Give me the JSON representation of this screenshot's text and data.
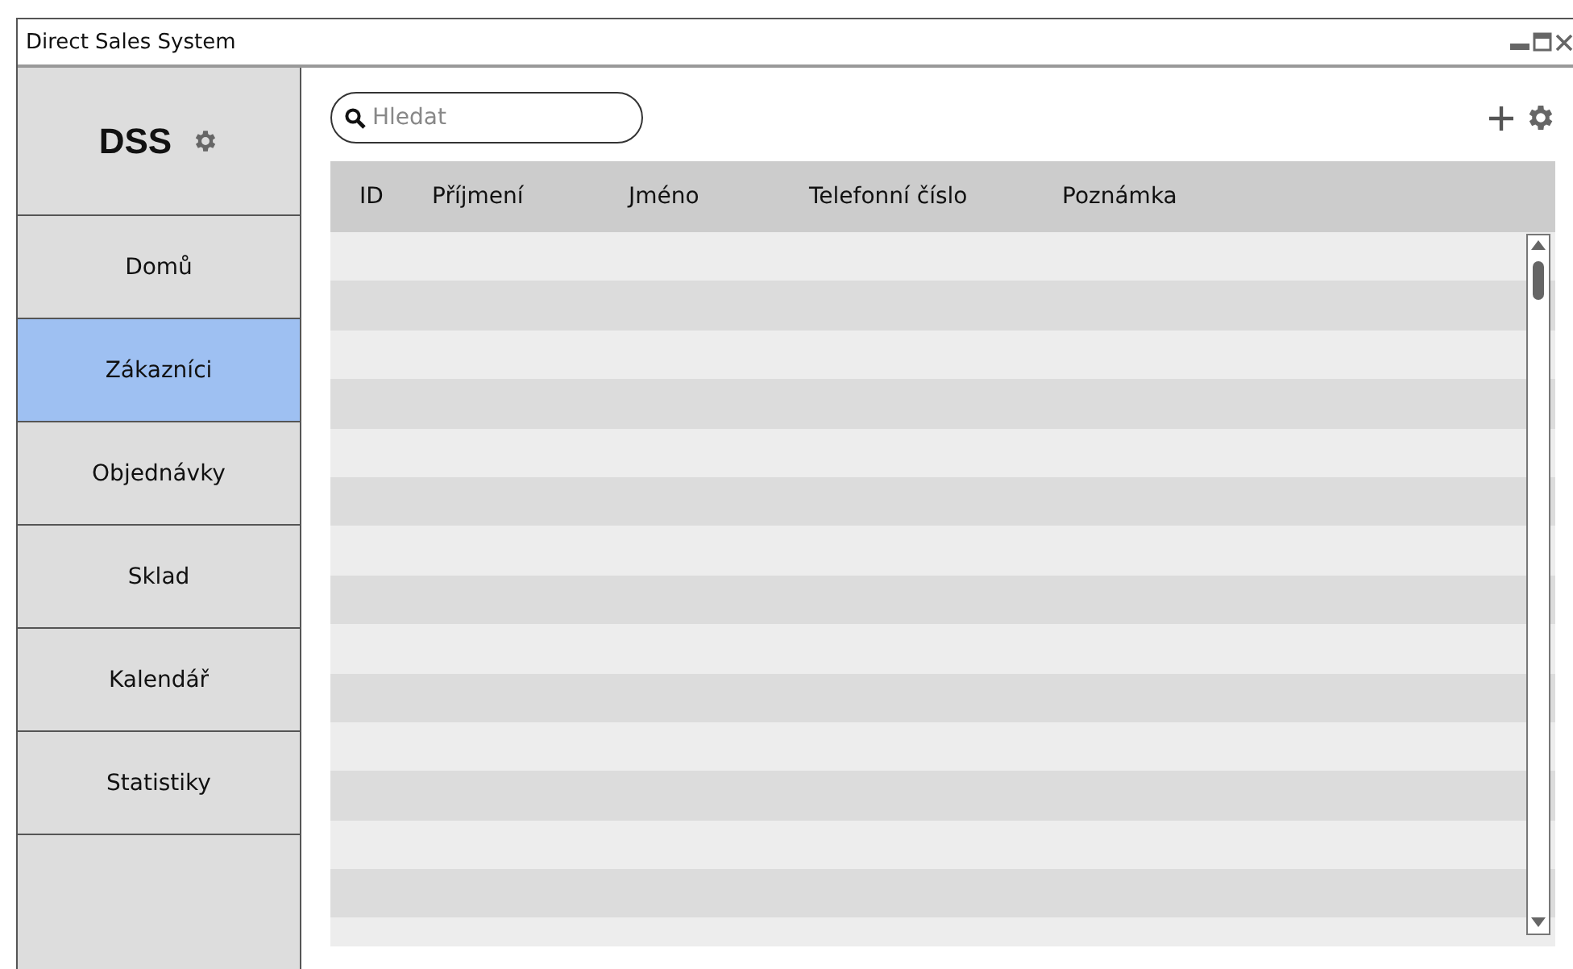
{
  "window": {
    "title": "Direct Sales System"
  },
  "logo": {
    "text": "DSS"
  },
  "sidebar": {
    "items": [
      {
        "label": "Domů",
        "selected": false
      },
      {
        "label": "Zákazníci",
        "selected": true
      },
      {
        "label": "Objednávky",
        "selected": false
      },
      {
        "label": "Sklad",
        "selected": false
      },
      {
        "label": "Kalendář",
        "selected": false
      },
      {
        "label": "Statistiky",
        "selected": false
      }
    ]
  },
  "search": {
    "placeholder": "Hledat"
  },
  "table": {
    "columns": [
      "ID",
      "Příjmení",
      "Jméno",
      "Telefonní číslo",
      "Poznámka"
    ]
  }
}
